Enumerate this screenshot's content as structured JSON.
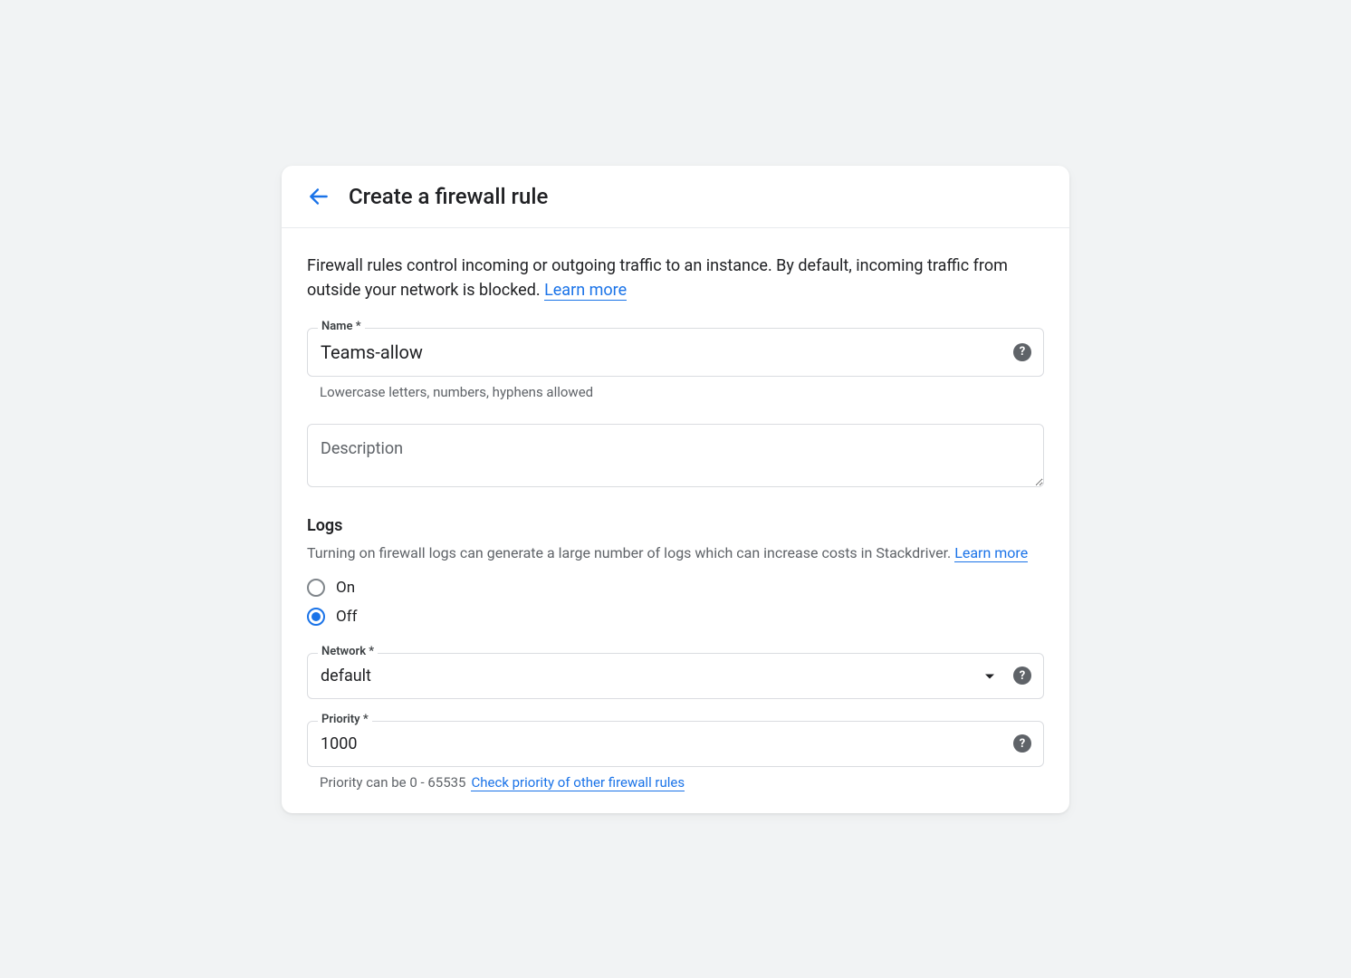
{
  "header": {
    "title": "Create a firewall rule"
  },
  "intro": {
    "text": "Firewall rules control incoming or outgoing traffic to an instance. By default, incoming traffic from outside your network is blocked. ",
    "learn_more": "Learn more"
  },
  "name_field": {
    "label": "Name *",
    "value": "Teams-allow",
    "helper": "Lowercase letters, numbers, hyphens allowed"
  },
  "description_field": {
    "placeholder": "Description"
  },
  "logs": {
    "title": "Logs",
    "desc": "Turning on firewall logs can generate a large number of logs which can increase costs in Stackdriver. ",
    "learn_more": "Learn more",
    "option_on": "On",
    "option_off": "Off",
    "selected": "off"
  },
  "network_field": {
    "label": "Network *",
    "value": "default"
  },
  "priority_field": {
    "label": "Priority *",
    "value": "1000",
    "helper_prefix": "Priority can be 0 - 65535",
    "helper_link": "Check priority of other firewall rules"
  }
}
